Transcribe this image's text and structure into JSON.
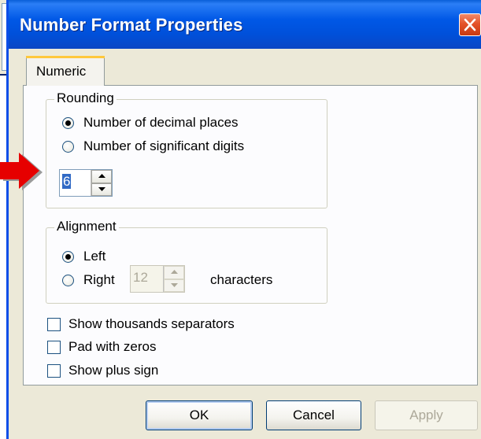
{
  "dialog": {
    "title": "Number Format Properties"
  },
  "tabs": [
    {
      "label": "Numeric",
      "active": true
    }
  ],
  "rounding": {
    "group_label": "Rounding",
    "options": [
      {
        "label": "Number of decimal places",
        "checked": true
      },
      {
        "label": "Number of significant digits",
        "checked": false
      }
    ],
    "spinner_value": "6"
  },
  "alignment": {
    "group_label": "Alignment",
    "left_label": "Left",
    "left_checked": true,
    "right_label": "Right",
    "right_checked": false,
    "spinner_value": "12",
    "spinner_enabled": false,
    "characters_label": "characters"
  },
  "checkboxes": [
    {
      "label": "Show thousands separators",
      "checked": false
    },
    {
      "label": "Pad with zeros",
      "checked": false
    },
    {
      "label": "Show plus sign",
      "checked": false
    }
  ],
  "buttons": {
    "ok": "OK",
    "cancel": "Cancel",
    "apply": "Apply"
  },
  "colors": {
    "title_bar": "#0058e6",
    "close_button": "#e4532a",
    "dialog_bg": "#ece9d8",
    "pointer_arrow": "#e60000"
  },
  "icons": {
    "close": "close-icon",
    "spin_up": "spin-up-icon",
    "spin_down": "spin-down-icon",
    "pointer": "red-arrow-icon"
  }
}
